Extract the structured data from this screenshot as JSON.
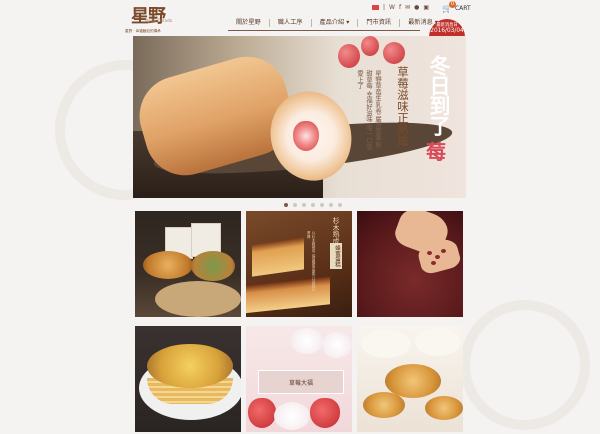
{
  "brand": {
    "name": "星野",
    "name_en": "Hoshi Dorado",
    "tagline": "星野 · 幸福麵包的傳承"
  },
  "header": {
    "cart_label": "CART",
    "cart_count": "0",
    "nav": [
      {
        "label": "關於星野"
      },
      {
        "label": "職人工序"
      },
      {
        "label": "產品介紹 ▾"
      },
      {
        "label": "門市資訊"
      },
      {
        "label": "最新消息 ▾"
      }
    ],
    "badge_line1": "最新消息日",
    "badge_line2": "2016/03/04"
  },
  "hero": {
    "title": "冬日到了",
    "title_accent": "莓",
    "subtitle": "草莓滋味正熟成",
    "small_text": "星野草莓生乳卷 嚴選當季鮮甜草莓 幸福好滋味 嚐一口就愛上了",
    "dots": 7,
    "active_dot": 0
  },
  "tiles": {
    "t2_title": "杉木熟成",
    "t2_sub": "蜂蜜蛋糕",
    "t2_text": "以杉木箱熟成 保留蜂蜜香氣 口感綿密濕潤",
    "t5_label": "草莓大福"
  },
  "colors": {
    "accent": "#c0302a",
    "brand_brown": "#7b4a2a"
  }
}
